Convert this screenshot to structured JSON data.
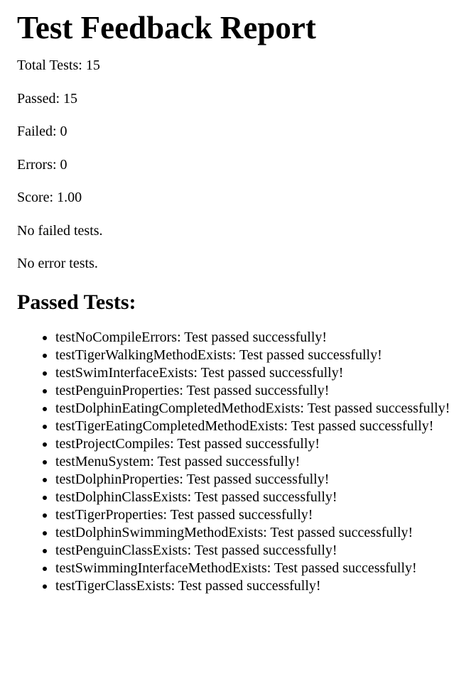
{
  "report": {
    "title": "Test Feedback Report",
    "summary": {
      "total": "Total Tests: 15",
      "passed": "Passed: 15",
      "failed": "Failed: 0",
      "errors": "Errors: 0",
      "score": "Score: 1.00"
    },
    "no_failed": "No failed tests.",
    "no_errors": "No error tests.",
    "passed_heading": "Passed Tests:",
    "passed_tests": [
      "testNoCompileErrors: Test passed successfully!",
      "testTigerWalkingMethodExists: Test passed successfully!",
      "testSwimInterfaceExists: Test passed successfully!",
      "testPenguinProperties: Test passed successfully!",
      "testDolphinEatingCompletedMethodExists: Test passed successfully!",
      "testTigerEatingCompletedMethodExists: Test passed successfully!",
      "testProjectCompiles: Test passed successfully!",
      "testMenuSystem: Test passed successfully!",
      "testDolphinProperties: Test passed successfully!",
      "testDolphinClassExists: Test passed successfully!",
      "testTigerProperties: Test passed successfully!",
      "testDolphinSwimmingMethodExists: Test passed successfully!",
      "testPenguinClassExists: Test passed successfully!",
      "testSwimmingInterfaceMethodExists: Test passed successfully!",
      "testTigerClassExists: Test passed successfully!"
    ]
  }
}
